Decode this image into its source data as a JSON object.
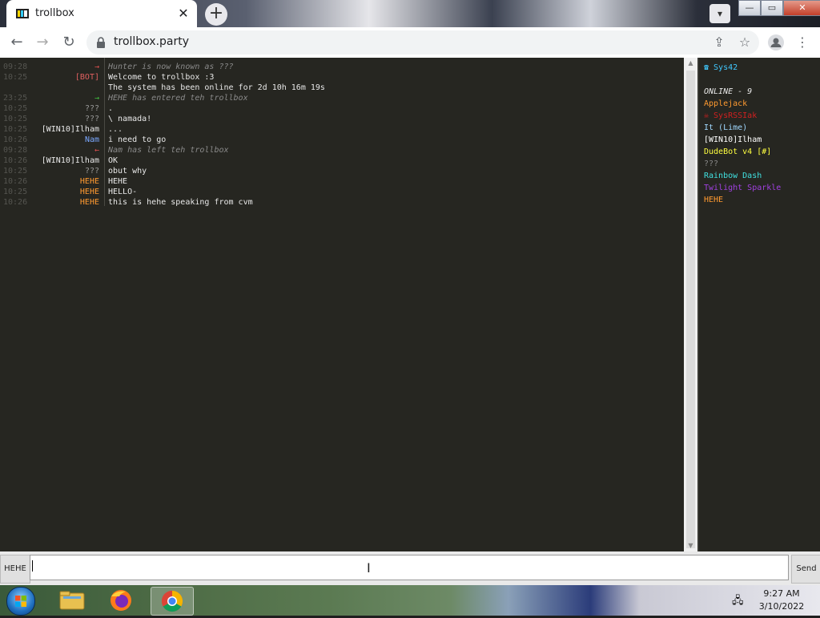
{
  "browser": {
    "tab_title": "trollbox",
    "new_tab_symbol": "+",
    "close_tab_symbol": "✕",
    "url": "trollbox.party",
    "icons": [
      "back-icon",
      "forward-icon",
      "reload-icon",
      "lock-icon",
      "share-icon",
      "star-icon",
      "profile-icon",
      "menu-icon"
    ]
  },
  "window_controls": {
    "minimize": "—",
    "maximize": "▭",
    "close": "✕"
  },
  "chat": {
    "rows": [
      {
        "ts": "09:28",
        "nick": "→",
        "nick_color": "#e05050",
        "text": "Hunter is now known as ???",
        "text_color": "#8a8a8a",
        "italic": true
      },
      {
        "ts": "10:25",
        "nick": "[BOT]",
        "nick_color": "#e06060",
        "text": "Welcome to trollbox :3",
        "text_color": "#e8e8e8",
        "italic": false
      },
      {
        "ts": "",
        "nick": "",
        "nick_color": "#e8e8e8",
        "text": "The system has been online for 2d 10h 16m 19s",
        "text_color": "#e8e8e8",
        "italic": false
      },
      {
        "ts": "23:25",
        "nick": "→",
        "nick_color": "#40c040",
        "text": "HEHE has entered teh trollbox",
        "text_color": "#8a8a8a",
        "italic": true
      },
      {
        "ts": "10:25",
        "nick": "???",
        "nick_color": "#9a9a9a",
        "text": ".",
        "text_color": "#e8e8e8",
        "italic": false
      },
      {
        "ts": "10:25",
        "nick": "???",
        "nick_color": "#9a9a9a",
        "text": "\\ namada!",
        "text_color": "#e8e8e8",
        "italic": false
      },
      {
        "ts": "10:25",
        "nick": "[WIN10]Ilham",
        "nick_color": "#e8e8e8",
        "text": "...",
        "text_color": "#e8e8e8",
        "italic": false
      },
      {
        "ts": "10:26",
        "nick": "Nam",
        "nick_color": "#7aa8ff",
        "text": "i need to go",
        "text_color": "#e8e8e8",
        "italic": false
      },
      {
        "ts": "09:28",
        "nick": "←",
        "nick_color": "#e05050",
        "text": "Nam has left teh trollbox",
        "text_color": "#8a8a8a",
        "italic": true
      },
      {
        "ts": "10:26",
        "nick": "[WIN10]Ilham",
        "nick_color": "#e8e8e8",
        "text": "OK",
        "text_color": "#e8e8e8",
        "italic": false
      },
      {
        "ts": "10:25",
        "nick": "???",
        "nick_color": "#9a9a9a",
        "text": "obut why",
        "text_color": "#e8e8e8",
        "italic": false
      },
      {
        "ts": "10:26",
        "nick": "HEHE",
        "nick_color": "#ff9a30",
        "text": "HEHE",
        "text_color": "#e8e8e8",
        "italic": false
      },
      {
        "ts": "10:25",
        "nick": "HEHE",
        "nick_color": "#ff9a30",
        "text": "HELLO-",
        "text_color": "#e8e8e8",
        "italic": false
      },
      {
        "ts": "10:26",
        "nick": "HEHE",
        "nick_color": "#ff9a30",
        "text": "this is hehe speaking from cvm",
        "text_color": "#e8e8e8",
        "italic": false
      }
    ]
  },
  "users": {
    "room": "☎ Sys42",
    "room_color": "#40c8ff",
    "online_label": "ONLINE - 9",
    "list": [
      {
        "name": "Applejack",
        "color": "#ff9a30"
      },
      {
        "name": "☠ SysRSSIak",
        "color": "#d02020"
      },
      {
        "name": "It (Lime)",
        "color": "#a0d8ff"
      },
      {
        "name": "[WIN10]Ilham",
        "color": "#ffffff"
      },
      {
        "name": "DudeBot v4 [#]",
        "color": "#ffff40"
      },
      {
        "name": "???",
        "color": "#8a8a8a"
      },
      {
        "name": "Rainbow Dash",
        "color": "#40e0e0"
      },
      {
        "name": "Twilight Sparkle",
        "color": "#a040e0"
      },
      {
        "name": "HEHE",
        "color": "#ff9a30"
      }
    ]
  },
  "input": {
    "nick_button": "HEHE",
    "value": "",
    "send_label": "Send"
  },
  "taskbar": {
    "time": "9:27 AM",
    "date": "3/10/2022"
  }
}
